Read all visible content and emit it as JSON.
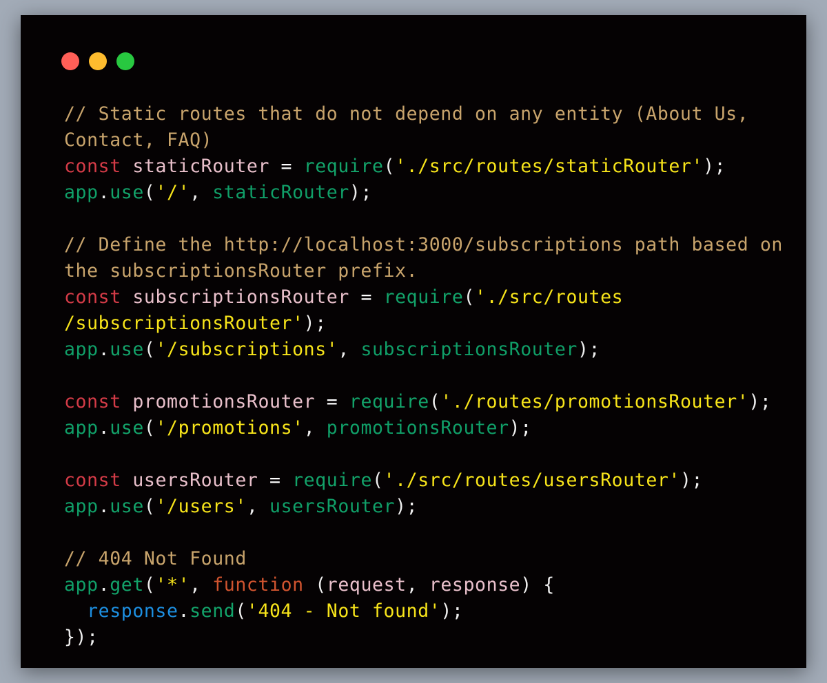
{
  "window": {
    "buttons": [
      {
        "name": "close",
        "color": "#ff5f57"
      },
      {
        "name": "minimize",
        "color": "#febc2e"
      },
      {
        "name": "maximize",
        "color": "#28c840"
      }
    ]
  },
  "code_lines": [
    {
      "tokens": [
        {
          "text": "// Static routes that do not depend on any entity (About Us,",
          "type": "comment"
        }
      ]
    },
    {
      "tokens": [
        {
          "text": "Contact, FAQ)",
          "type": "comment"
        }
      ]
    },
    {
      "tokens": [
        {
          "text": "const",
          "type": "keyword"
        },
        {
          "text": " ",
          "type": "punct"
        },
        {
          "text": "staticRouter",
          "type": "variable"
        },
        {
          "text": " = ",
          "type": "operator"
        },
        {
          "text": "require",
          "type": "call"
        },
        {
          "text": "(",
          "type": "punct"
        },
        {
          "text": "'./src/routes/staticRouter'",
          "type": "string"
        },
        {
          "text": ");",
          "type": "punct"
        }
      ]
    },
    {
      "tokens": [
        {
          "text": "app",
          "type": "object"
        },
        {
          "text": ".",
          "type": "punct"
        },
        {
          "text": "use",
          "type": "call"
        },
        {
          "text": "(",
          "type": "punct"
        },
        {
          "text": "'/'",
          "type": "string"
        },
        {
          "text": ", ",
          "type": "punct"
        },
        {
          "text": "staticRouter",
          "type": "object"
        },
        {
          "text": ");",
          "type": "punct"
        }
      ]
    },
    {
      "tokens": []
    },
    {
      "tokens": [
        {
          "text": "// Define the http://localhost:3000/subscriptions path based on",
          "type": "comment"
        }
      ]
    },
    {
      "tokens": [
        {
          "text": "the subscriptionsRouter prefix.",
          "type": "comment"
        }
      ]
    },
    {
      "tokens": [
        {
          "text": "const",
          "type": "keyword"
        },
        {
          "text": " ",
          "type": "punct"
        },
        {
          "text": "subscriptionsRouter",
          "type": "variable"
        },
        {
          "text": " = ",
          "type": "operator"
        },
        {
          "text": "require",
          "type": "call"
        },
        {
          "text": "(",
          "type": "punct"
        },
        {
          "text": "'./src/routes",
          "type": "string"
        }
      ]
    },
    {
      "tokens": [
        {
          "text": "/subscriptionsRouter'",
          "type": "string"
        },
        {
          "text": ");",
          "type": "punct"
        }
      ]
    },
    {
      "tokens": [
        {
          "text": "app",
          "type": "object"
        },
        {
          "text": ".",
          "type": "punct"
        },
        {
          "text": "use",
          "type": "call"
        },
        {
          "text": "(",
          "type": "punct"
        },
        {
          "text": "'/subscriptions'",
          "type": "string"
        },
        {
          "text": ", ",
          "type": "punct"
        },
        {
          "text": "subscriptionsRouter",
          "type": "object"
        },
        {
          "text": ");",
          "type": "punct"
        }
      ]
    },
    {
      "tokens": []
    },
    {
      "tokens": [
        {
          "text": "const",
          "type": "keyword"
        },
        {
          "text": " ",
          "type": "punct"
        },
        {
          "text": "promotionsRouter",
          "type": "variable"
        },
        {
          "text": " = ",
          "type": "operator"
        },
        {
          "text": "require",
          "type": "call"
        },
        {
          "text": "(",
          "type": "punct"
        },
        {
          "text": "'./routes/promotionsRouter'",
          "type": "string"
        },
        {
          "text": ");",
          "type": "punct"
        }
      ]
    },
    {
      "tokens": [
        {
          "text": "app",
          "type": "object"
        },
        {
          "text": ".",
          "type": "punct"
        },
        {
          "text": "use",
          "type": "call"
        },
        {
          "text": "(",
          "type": "punct"
        },
        {
          "text": "'/promotions'",
          "type": "string"
        },
        {
          "text": ", ",
          "type": "punct"
        },
        {
          "text": "promotionsRouter",
          "type": "object"
        },
        {
          "text": ");",
          "type": "punct"
        }
      ]
    },
    {
      "tokens": []
    },
    {
      "tokens": [
        {
          "text": "const",
          "type": "keyword"
        },
        {
          "text": " ",
          "type": "punct"
        },
        {
          "text": "usersRouter",
          "type": "variable"
        },
        {
          "text": " = ",
          "type": "operator"
        },
        {
          "text": "require",
          "type": "call"
        },
        {
          "text": "(",
          "type": "punct"
        },
        {
          "text": "'./src/routes/usersRouter'",
          "type": "string"
        },
        {
          "text": ");",
          "type": "punct"
        }
      ]
    },
    {
      "tokens": [
        {
          "text": "app",
          "type": "object"
        },
        {
          "text": ".",
          "type": "punct"
        },
        {
          "text": "use",
          "type": "call"
        },
        {
          "text": "(",
          "type": "punct"
        },
        {
          "text": "'/users'",
          "type": "string"
        },
        {
          "text": ", ",
          "type": "punct"
        },
        {
          "text": "usersRouter",
          "type": "object"
        },
        {
          "text": ");",
          "type": "punct"
        }
      ]
    },
    {
      "tokens": []
    },
    {
      "tokens": [
        {
          "text": "// 404 Not Found",
          "type": "comment"
        }
      ]
    },
    {
      "tokens": [
        {
          "text": "app",
          "type": "object"
        },
        {
          "text": ".",
          "type": "punct"
        },
        {
          "text": "get",
          "type": "call"
        },
        {
          "text": "(",
          "type": "punct"
        },
        {
          "text": "'*'",
          "type": "string"
        },
        {
          "text": ", ",
          "type": "punct"
        },
        {
          "text": "function",
          "type": "fn-keyword"
        },
        {
          "text": " (",
          "type": "punct"
        },
        {
          "text": "request",
          "type": "variable"
        },
        {
          "text": ", ",
          "type": "punct"
        },
        {
          "text": "response",
          "type": "variable"
        },
        {
          "text": ") {",
          "type": "punct"
        }
      ]
    },
    {
      "tokens": [
        {
          "text": "  ",
          "type": "punct"
        },
        {
          "text": "response",
          "type": "special-var"
        },
        {
          "text": ".",
          "type": "punct"
        },
        {
          "text": "send",
          "type": "call"
        },
        {
          "text": "(",
          "type": "punct"
        },
        {
          "text": "'404 - Not found'",
          "type": "string"
        },
        {
          "text": ");",
          "type": "punct"
        }
      ]
    },
    {
      "tokens": [
        {
          "text": "});",
          "type": "punct"
        }
      ]
    }
  ]
}
